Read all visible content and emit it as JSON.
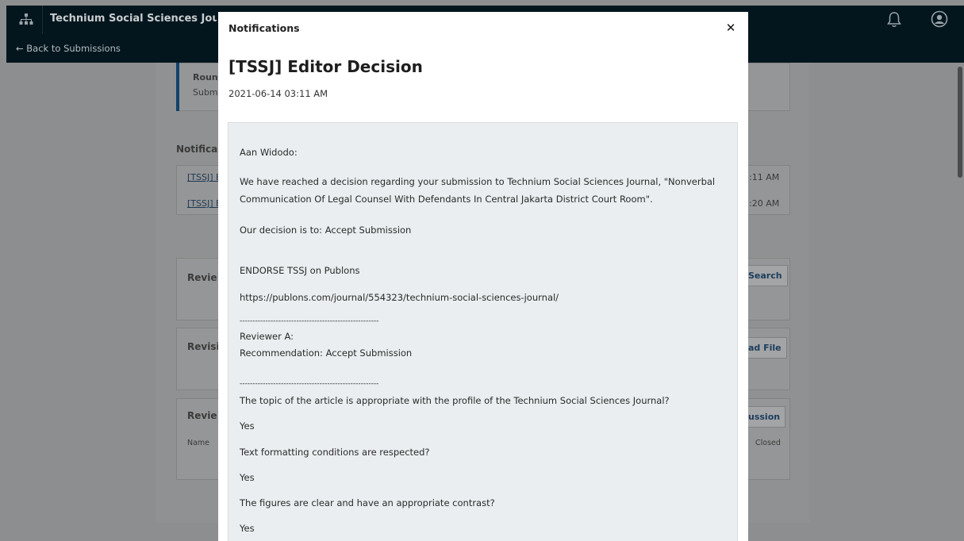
{
  "header": {
    "journal_title": "Technium Social Sciences Journal",
    "back_link": "← Back to Submissions"
  },
  "background": {
    "round_label": "Round",
    "submission_label": "Subm",
    "notifications_heading": "Notifica",
    "notification_links": [
      "[TSSJ] E",
      "[TSSJ] E"
    ],
    "notification_times": [
      ":11 AM",
      ":20 AM"
    ],
    "review_heading": "Revie",
    "revision_heading": "Revisi",
    "review_discussion_heading": "Revie",
    "name_column": "Name",
    "closed_column": "Closed",
    "search_button": "Search",
    "upload_button": "ad File",
    "discussion_button": "ussion"
  },
  "modal": {
    "header": "Notifications",
    "close_icon": "close-icon",
    "title": "[TSSJ] Editor Decision",
    "date": "2021-06-14 03:11 AM",
    "body": {
      "greeting": "Aan Widodo:",
      "line1": "We have reached a decision regarding your submission to Technium Social Sciences Journal, \"Nonverbal",
      "line2": "Communication Of Legal Counsel With Defendants In Central Jakarta District Court Room\".",
      "decision": "Our decision is to: Accept Submission",
      "endorse": "ENDORSE  TSSJ on Publons",
      "url": "https://publons.com/journal/554323/technium-social-sciences-journal/",
      "divider1": "------------------------------------------------------",
      "reviewer": "Reviewer A:",
      "recommendation": "Recommendation: Accept Submission",
      "divider2": "------------------------------------------------------",
      "q1": "The topic of the article is appropriate with the profile of the Technium Social Sciences Journal?",
      "a1": "Yes",
      "q2": "Text formatting conditions are respected?",
      "a2": "Yes",
      "q3": "The figures are clear and have an appropriate contrast?",
      "a3": "Yes"
    }
  }
}
